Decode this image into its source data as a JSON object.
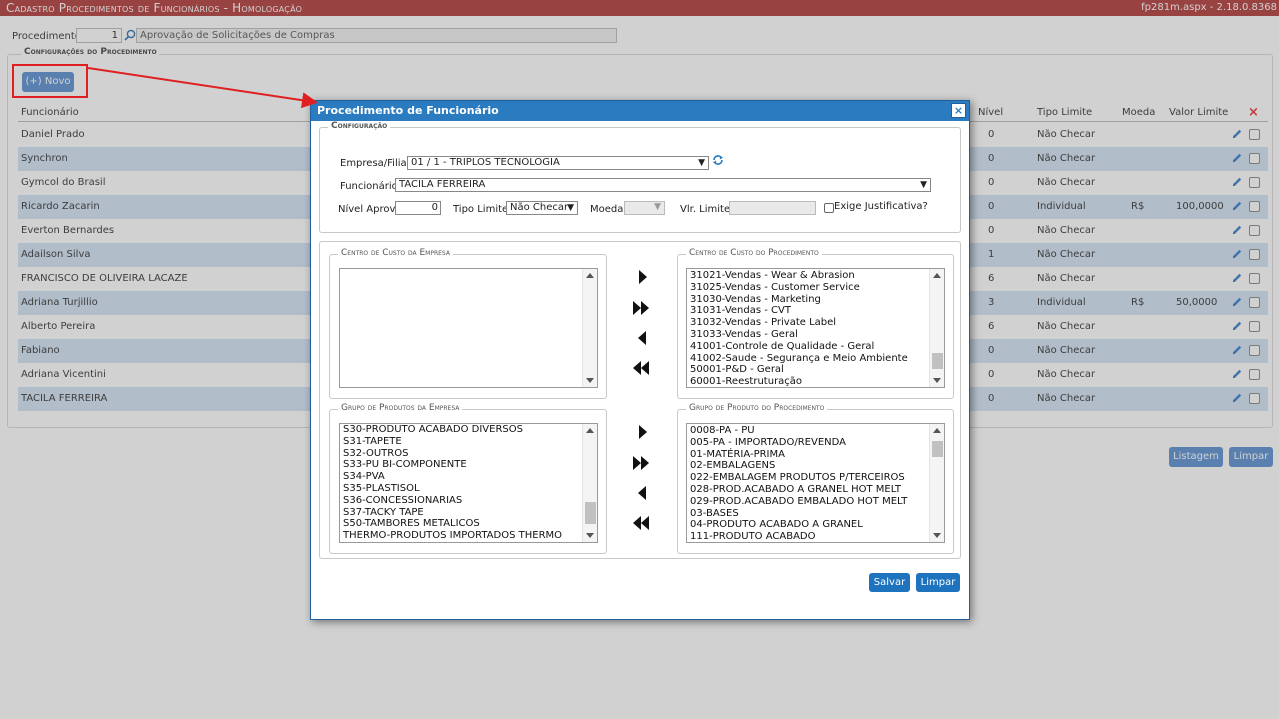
{
  "page": {
    "title": "Cadastro Procedimentos de Funcionários  - Homologação",
    "version": "fp281m.aspx - 2.18.0.8368",
    "procedure_label": "Procedimento:",
    "procedure_code": "1",
    "procedure_desc": "Aprovação de Solicitações de Compras",
    "config_legend": "Configurações do Procedimento",
    "new_button": "(+) Novo",
    "columns": {
      "funcionario": "Funcionário",
      "nivel": "Nível",
      "tipo_limite": "Tipo Limite",
      "moeda": "Moeda",
      "valor_limite": "Valor Limite"
    },
    "rows": [
      {
        "name": "Daniel Prado",
        "nivel": "0",
        "tipo": "Não Checar",
        "moeda": "",
        "valor": ""
      },
      {
        "name": "Synchron",
        "nivel": "0",
        "tipo": "Não Checar",
        "moeda": "",
        "valor": ""
      },
      {
        "name": "Gymcol do Brasil",
        "nivel": "0",
        "tipo": "Não Checar",
        "moeda": "",
        "valor": ""
      },
      {
        "name": "Ricardo Zacarin",
        "nivel": "0",
        "tipo": "Individual",
        "moeda": "R$",
        "valor": "100,0000"
      },
      {
        "name": "Everton Bernardes",
        "nivel": "0",
        "tipo": "Não Checar",
        "moeda": "",
        "valor": ""
      },
      {
        "name": "Adailson Silva",
        "nivel": "1",
        "tipo": "Não Checar",
        "moeda": "",
        "valor": ""
      },
      {
        "name": "FRANCISCO DE OLIVEIRA LACAZE",
        "nivel": "6",
        "tipo": "Não Checar",
        "moeda": "",
        "valor": ""
      },
      {
        "name": "Adriana Turjillio",
        "nivel": "3",
        "tipo": "Individual",
        "moeda": "R$",
        "valor": "50,0000"
      },
      {
        "name": "Alberto Pereira",
        "nivel": "6",
        "tipo": "Não Checar",
        "moeda": "",
        "valor": ""
      },
      {
        "name": "Fabiano",
        "nivel": "0",
        "tipo": "Não Checar",
        "moeda": "",
        "valor": ""
      },
      {
        "name": "Adriana Vicentini",
        "nivel": "0",
        "tipo": "Não Checar",
        "moeda": "",
        "valor": ""
      },
      {
        "name": "TACILA FERREIRA",
        "nivel": "0",
        "tipo": "Não Checar",
        "moeda": "",
        "valor": ""
      }
    ],
    "listagem_button": "Listagem",
    "limpar_button": "Limpar"
  },
  "modal": {
    "title": "Procedimento de Funcionário",
    "close": "×",
    "config_legend": "Configuração",
    "empresa_label": "Empresa/Filial:",
    "empresa_value": "01 / 1 - TRIPLOS TECNOLOGIA",
    "funcionario_label": "Funcionário:",
    "funcionario_value": "TACILA FERREIRA",
    "nivel_label": "Nível Aprov.:",
    "nivel_value": "0",
    "tipo_label": "Tipo Limite:",
    "tipo_value": "Não Checar",
    "moeda_label": "Moeda:",
    "vlr_label": "Vlr. Limite:",
    "justificativa_label": "Exige Justificativa?",
    "cc_empresa_legend": "Centro de Custo da Empresa",
    "cc_proc_legend": "Centro de Custo do Procedimento",
    "cc_proc_items": [
      "31021-Vendas - Wear & Abrasion",
      "31025-Vendas - Customer Service",
      "31030-Vendas - Marketing",
      "31031-Vendas - CVT",
      "31032-Vendas - Private Label",
      "31033-Vendas - Geral",
      "41001-Controle de Qualidade - Geral",
      "41002-Saude - Segurança e Meio Ambiente",
      "50001-P&D - Geral",
      "60001-Reestruturação"
    ],
    "gp_empresa_legend": "Grupo de Produtos da Empresa",
    "gp_empresa_items": [
      "S30-PRODUTO ACABADO DIVERSOS",
      "S31-TAPETE",
      "S32-OUTROS",
      "S33-PU BI-COMPONENTE",
      "S34-PVA",
      "S35-PLASTISOL",
      "S36-CONCESSIONARIAS",
      "S37-TACKY TAPE",
      "S50-TAMBORES METALICOS",
      "THERMO-PRODUTOS IMPORTADOS THERMO"
    ],
    "gp_proc_legend": "Grupo de Produto do Procedimento",
    "gp_proc_items": [
      "0008-PA - PU",
      "005-PA - IMPORTADO/REVENDA",
      "01-MATÉRIA-PRIMA",
      "02-EMBALAGENS",
      "022-EMBALAGEM PRODUTOS P/TERCEIROS",
      "028-PROD.ACABADO A GRANEL HOT MELT",
      "029-PROD.ACABADO EMBALADO HOT MELT",
      "03-BASES",
      "04-PRODUTO ACABADO A GRANEL",
      "111-PRODUTO ACABADO"
    ],
    "salvar_button": "Salvar",
    "limpar_button": "Limpar"
  },
  "icons": {
    "search": "search-icon",
    "refresh": "refresh-icon",
    "edit": "pencil-icon",
    "delete_all": "close-icon",
    "move_right": "triangle-right-icon",
    "move_all_right": "double-triangle-right-icon",
    "move_left": "triangle-left-icon",
    "move_all_left": "double-triangle-left-icon"
  },
  "colors": {
    "title_bar": "#b13a3a",
    "modal_header": "#2a7bbf",
    "button": "#1e73be",
    "row_alt": "#d3e3f4",
    "annotation": "#e02020"
  }
}
